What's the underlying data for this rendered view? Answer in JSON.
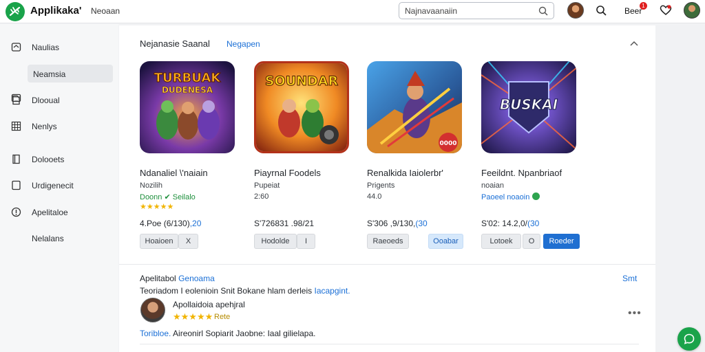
{
  "header": {
    "app_title": "Applikaka'",
    "app_subtitle": "Neoaan",
    "search_placeholder": "Najnavaanaiin",
    "right_label": "Beer",
    "notification_count": "1",
    "icons": [
      "logo-icon",
      "search-icon",
      "heart-icon",
      "avatar"
    ]
  },
  "sidebar": {
    "items": [
      {
        "label": "Naulias",
        "icon": "home-icon"
      },
      {
        "label": "Neamsia",
        "icon": "folder-icon",
        "active": true
      },
      {
        "label": "Dlooual",
        "icon": "document-icon"
      },
      {
        "label": "Nenlys",
        "icon": "grid-icon"
      },
      {
        "label": "Dolooets",
        "icon": "book-icon"
      },
      {
        "label": "Urdigenecit",
        "icon": "chat-icon"
      },
      {
        "label": "Apelitaloe",
        "icon": "info-icon"
      },
      {
        "label": "Nelalans",
        "icon": ""
      }
    ]
  },
  "section": {
    "title": "Nejanasie Saanal",
    "link": "Negapen"
  },
  "apps": [
    {
      "art_title": "TURBUAK",
      "art_subtitle": "DUDENESA",
      "name": "Ndanaliel \\'naiain",
      "meta": "Nozilih",
      "line2": "Doonn ✔ Seilalo",
      "stars": "★★★★★",
      "price": "4.Poe (6/130)",
      "price_suffix": ",20",
      "btn1": "Hoaioen",
      "btn2": "X"
    },
    {
      "art_title": "SOUNDAR",
      "name": "Piayrnal Foodels",
      "meta": "Pupeiat",
      "line2": "2:60",
      "price": "S'726831 .98/21",
      "btn1": "Hodolde",
      "btn2": "I"
    },
    {
      "art_badge": "0000",
      "name": "Renalkida Iaiolerbr'",
      "meta": "Prigents",
      "line2": "44.0",
      "price": "S'306 ,9/130,",
      "price_suffix": "(30",
      "btn1": "Raeoeds",
      "btn2": "Ooabar"
    },
    {
      "art_title": "BUSKAI",
      "name": "Feeildnt. Npanbriaof",
      "meta": "noaian",
      "line2": "Paoeel noaoin",
      "price": "S'02: 14.2,0/",
      "price_suffix": "(30",
      "btn1": "Lotoek",
      "btn2": "O",
      "btn3": "Roeder"
    }
  ],
  "reviews": {
    "title": "Apelitabol",
    "title_link": "Genoama",
    "more": "Smt",
    "description": "Teoriadom I eolenioin Snit Bokane hlam derleis",
    "description_link": "Iacapgint.",
    "reviewer_name": "Apollaidoia  apehjral",
    "reviewer_stars": "★★★★★",
    "reviewer_rating": "Rete",
    "reviewer_more": "•••",
    "text_link": "Toribloe.",
    "text": " Aireonirl Sopiarit Jaobne: Iaal gilielapa."
  },
  "colors": {
    "brand_green": "#1aa34a",
    "link_blue": "#1a6fd6",
    "primary_button": "#1f6fd1",
    "star": "#f1b400"
  }
}
